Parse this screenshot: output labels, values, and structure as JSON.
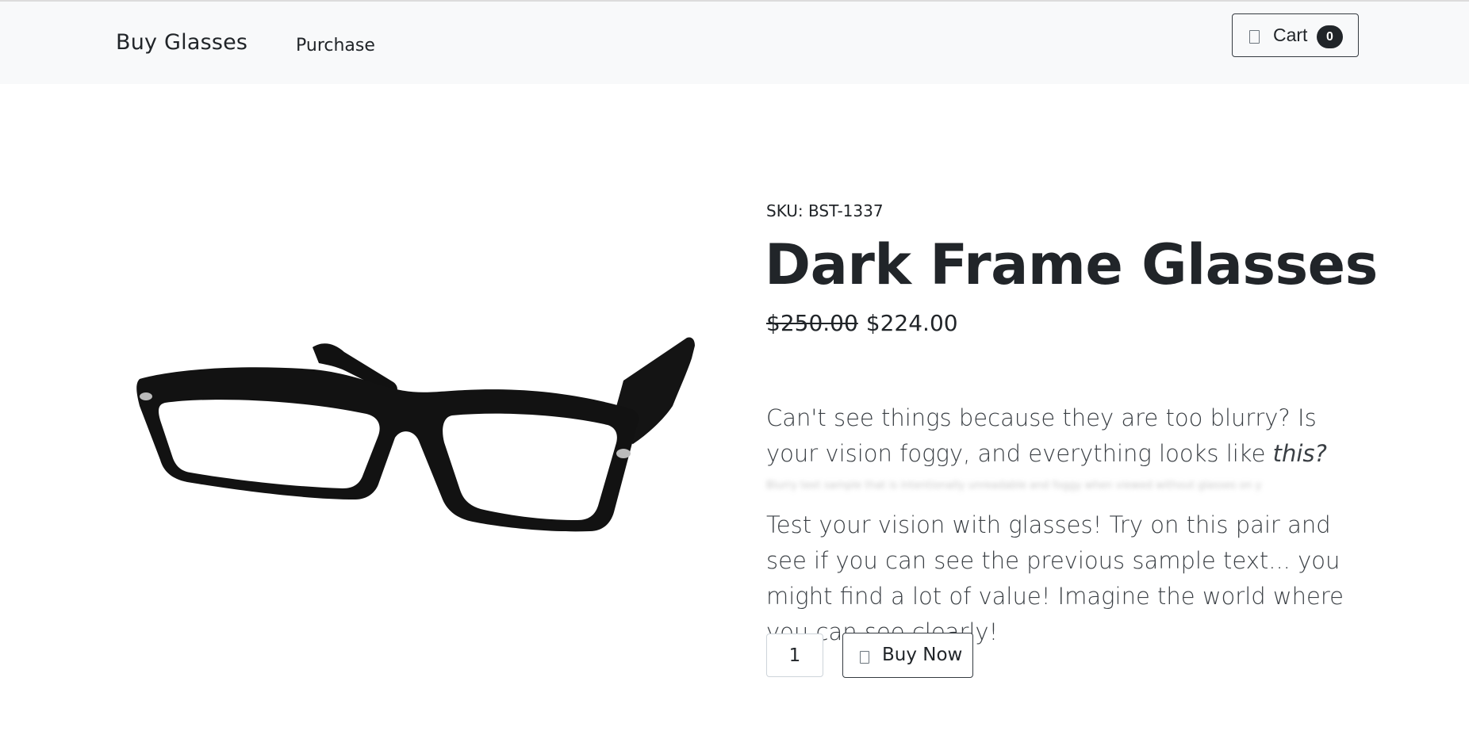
{
  "navbar": {
    "brand": "Buy Glasses",
    "links": [
      {
        "label": "Purchase"
      }
    ],
    "cart": {
      "label": "Cart",
      "count": "0",
      "icon": "cart-icon"
    }
  },
  "product": {
    "image_alt": "Dark frame glasses",
    "sku": "SKU: BST-1337",
    "title": "Dark Frame Glasses",
    "price_old": "$250.00",
    "price_new": "$224.00",
    "desc1_part1": "Can't see things because they are too blurry? Is your vision foggy, and everything looks like ",
    "desc1_em": "this?",
    "blurry_sample": "Blurry text sample that is intentionally unreadable and foggy when viewed without glasses on your face",
    "desc2": "Test your vision with glasses! Try on this pair and see if you can see the previous sample text... you might find a lot of value! Imagine the world where you can see clearly!",
    "quantity": "1",
    "buy_label": "Buy Now",
    "buy_icon": "cart-icon"
  }
}
